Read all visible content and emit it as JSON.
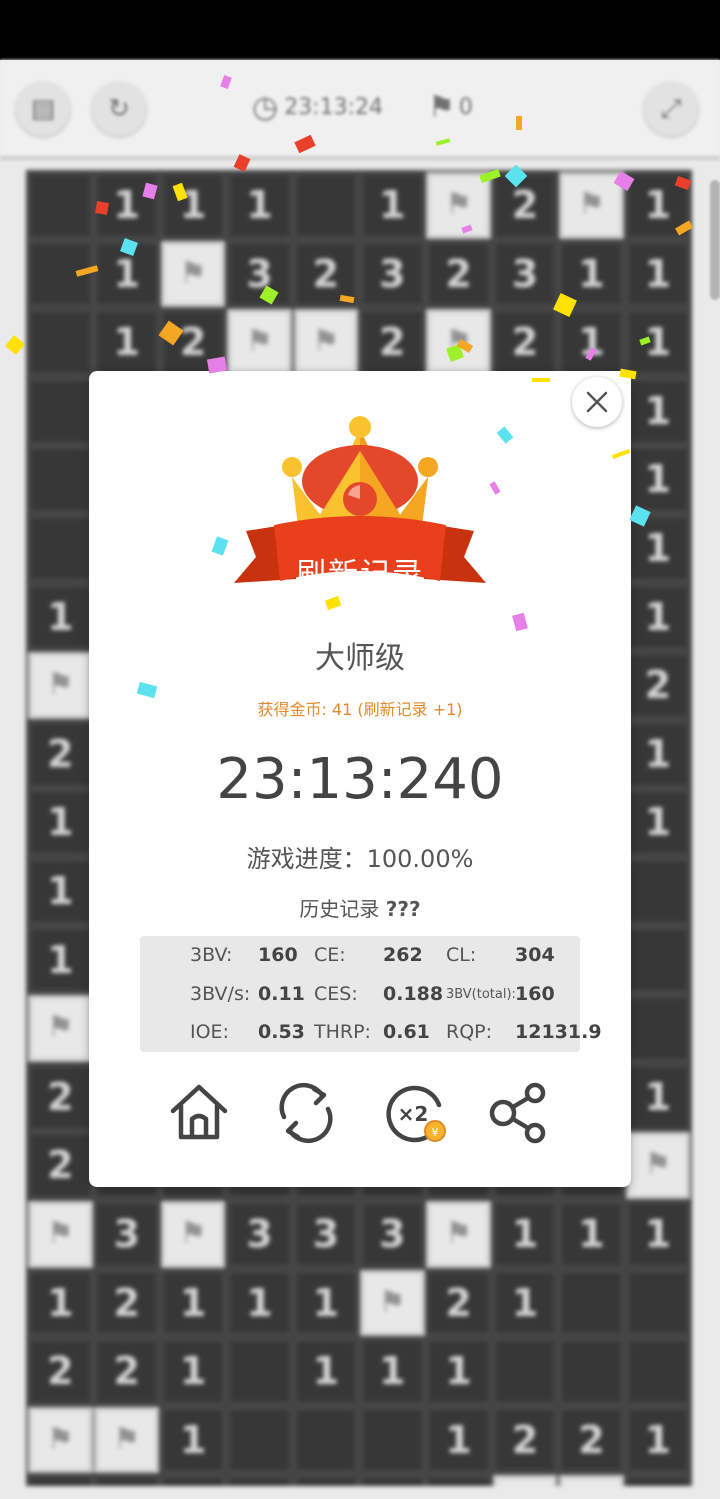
{
  "topbar": {
    "menu_icon": "list-icon",
    "refresh_icon": "refresh-icon",
    "timer": "23:13:24",
    "flags": "0",
    "settings_icon": "expand-icon"
  },
  "board": {
    "rows": [
      [
        "",
        "1",
        "1",
        "1",
        "",
        "1",
        "F",
        "2",
        "F",
        "1"
      ],
      [
        "",
        "1",
        "F",
        "3",
        "2",
        "3",
        "2",
        "3",
        "1",
        "1"
      ],
      [
        "",
        "1",
        "2",
        "F",
        "F",
        "2",
        "F",
        "2",
        "1",
        "1"
      ],
      [
        "",
        "",
        "",
        "",
        "",
        "",
        "",
        "",
        "",
        "1"
      ],
      [
        "",
        "",
        "",
        "",
        "",
        "",
        "",
        "",
        "",
        "1"
      ],
      [
        "",
        "",
        "",
        "",
        "",
        "",
        "",
        "",
        "",
        "1"
      ],
      [
        "1",
        "",
        "",
        "",
        "",
        "",
        "",
        "",
        "",
        "1"
      ],
      [
        "F",
        "",
        "",
        "",
        "",
        "",
        "",
        "",
        "",
        "2"
      ],
      [
        "2",
        "",
        "",
        "",
        "",
        "",
        "",
        "",
        "",
        "1"
      ],
      [
        "1",
        "",
        "",
        "",
        "",
        "",
        "",
        "",
        "",
        "1"
      ],
      [
        "1",
        "",
        "",
        "",
        "",
        "",
        "",
        "",
        "",
        ""
      ],
      [
        "1",
        "",
        "",
        "",
        "",
        "",
        "",
        "",
        "",
        ""
      ],
      [
        "F",
        "",
        "",
        "",
        "",
        "",
        "",
        "",
        "",
        ""
      ],
      [
        "2",
        "",
        "",
        "",
        "",
        "",
        "",
        "",
        "",
        "1"
      ],
      [
        "2",
        "",
        "",
        "",
        "",
        "",
        "",
        "",
        "",
        "F"
      ],
      [
        "F",
        "3",
        "F",
        "3",
        "3",
        "3",
        "F",
        "1",
        "1",
        "1"
      ],
      [
        "1",
        "2",
        "1",
        "1",
        "1",
        "F",
        "2",
        "1",
        "",
        ""
      ],
      [
        "2",
        "2",
        "1",
        "",
        "1",
        "1",
        "1",
        "",
        "",
        ""
      ],
      [
        "F",
        "F",
        "1",
        "",
        "",
        "",
        "1",
        "2",
        "2",
        "1"
      ],
      [
        "2",
        "2",
        "1",
        "",
        "",
        "",
        "1",
        "F",
        "F",
        "2"
      ]
    ]
  },
  "dialog": {
    "banner": "刷新记录",
    "rank": "大师级",
    "coins": "获得金币: 41 (刷新记录 +1)",
    "time": "23:13:240",
    "progress": "游戏进度：100.00%",
    "history_label": "历史记录",
    "history_value": "???",
    "stats": {
      "bv_label": "3BV:",
      "bv": "160",
      "ce_label": "CE:",
      "ce": "262",
      "cl_label": "CL:",
      "cl": "304",
      "bvs_label": "3BV/s:",
      "bvs": "0.11",
      "ces_label": "CES:",
      "ces": "0.188",
      "bvt_label": "3BV(total):",
      "bvt": "160",
      "ioe_label": "IOE:",
      "ioe": "0.53",
      "thrp_label": "THRP:",
      "thrp": "0.61",
      "rqp_label": "RQP:",
      "rqp": "12131.9"
    },
    "actions": {
      "home_icon": "home-icon",
      "restart_icon": "restart-icon",
      "double_icon": "double-reward-icon",
      "double_label": "×2",
      "coin_symbol": "¥",
      "share_icon": "share-icon"
    }
  },
  "colors": {
    "accent_orange": "#e08b2b",
    "banner_red": "#e8401c",
    "crown_gold": "#f7b52b",
    "board_dark": "#3a3a3a",
    "flag_cell": "#f2f2f2"
  }
}
